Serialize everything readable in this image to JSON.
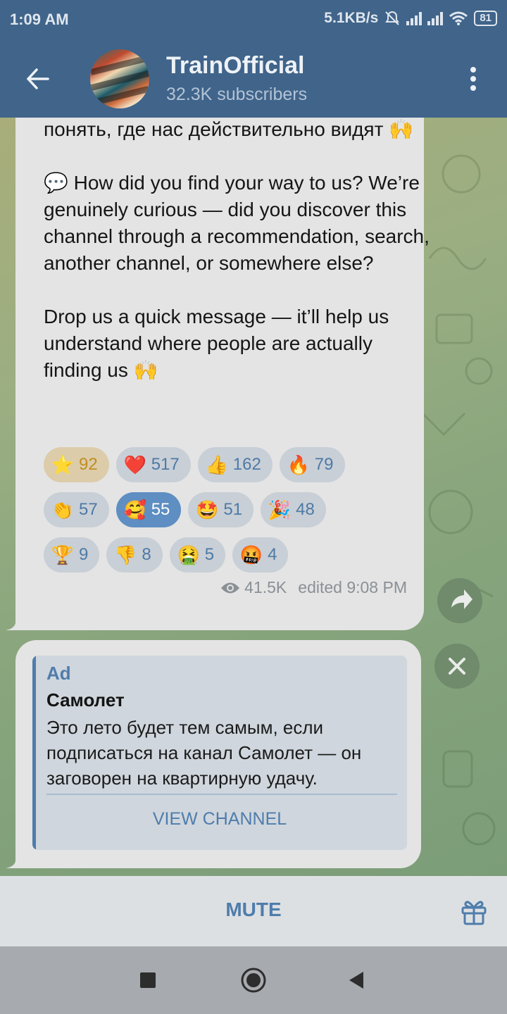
{
  "status_bar": {
    "time": "1:09 AM",
    "network_speed": "5.1KB/s",
    "battery": "81",
    "icons": [
      "silent-alarm-icon",
      "signal-icon",
      "signal-icon",
      "wifi-icon",
      "battery-icon"
    ]
  },
  "header": {
    "title": "TrainOfficial",
    "subtitle": "32.3K subscribers",
    "back_icon": "arrow-left-icon",
    "menu_icon": "more-vert-icon"
  },
  "message": {
    "text": "Напишите пару слов — это поможет нам понять, где нас действительно видят 🙌\n\n💬 How did you find your way to us? We’re genuinely curious — did you discover this channel through a recommendation, search, another channel, or somewhere else?\n\nDrop us a quick message — it’ll help us understand where people are actually finding us 🙌",
    "views": "41.5K",
    "edited": "edited 9:08 PM",
    "reactions": [
      [
        {
          "emoji": "⭐",
          "count": "92",
          "style": "gold"
        },
        {
          "emoji": "❤️",
          "count": "517",
          "style": "normal"
        },
        {
          "emoji": "👍",
          "count": "162",
          "style": "normal"
        },
        {
          "emoji": "🔥",
          "count": "79",
          "style": "normal"
        }
      ],
      [
        {
          "emoji": "👏",
          "count": "57",
          "style": "normal"
        },
        {
          "emoji": "🥰",
          "count": "55",
          "style": "active"
        },
        {
          "emoji": "🤩",
          "count": "51",
          "style": "normal"
        },
        {
          "emoji": "🎉",
          "count": "48",
          "style": "normal"
        }
      ],
      [
        {
          "emoji": "🏆",
          "count": "9",
          "style": "normal"
        },
        {
          "emoji": "👎",
          "count": "8",
          "style": "normal"
        },
        {
          "emoji": "🤮",
          "count": "5",
          "style": "normal"
        },
        {
          "emoji": "🤬",
          "count": "4",
          "style": "normal"
        }
      ]
    ]
  },
  "ad": {
    "label": "Ad",
    "title": "Самолет",
    "text": "Это лето будет тем самым, если подписаться на канал Самолет — он заговорен на квартирную удачу.",
    "cta": "VIEW CHANNEL"
  },
  "bottom_bar": {
    "mute_label": "MUTE",
    "gift_icon": "gift-icon"
  },
  "colors": {
    "header_bg": "#40648a",
    "accent": "#4f7dac",
    "bubble_bg": "#e4e4e4",
    "active_reaction": "#5e8ec2"
  }
}
